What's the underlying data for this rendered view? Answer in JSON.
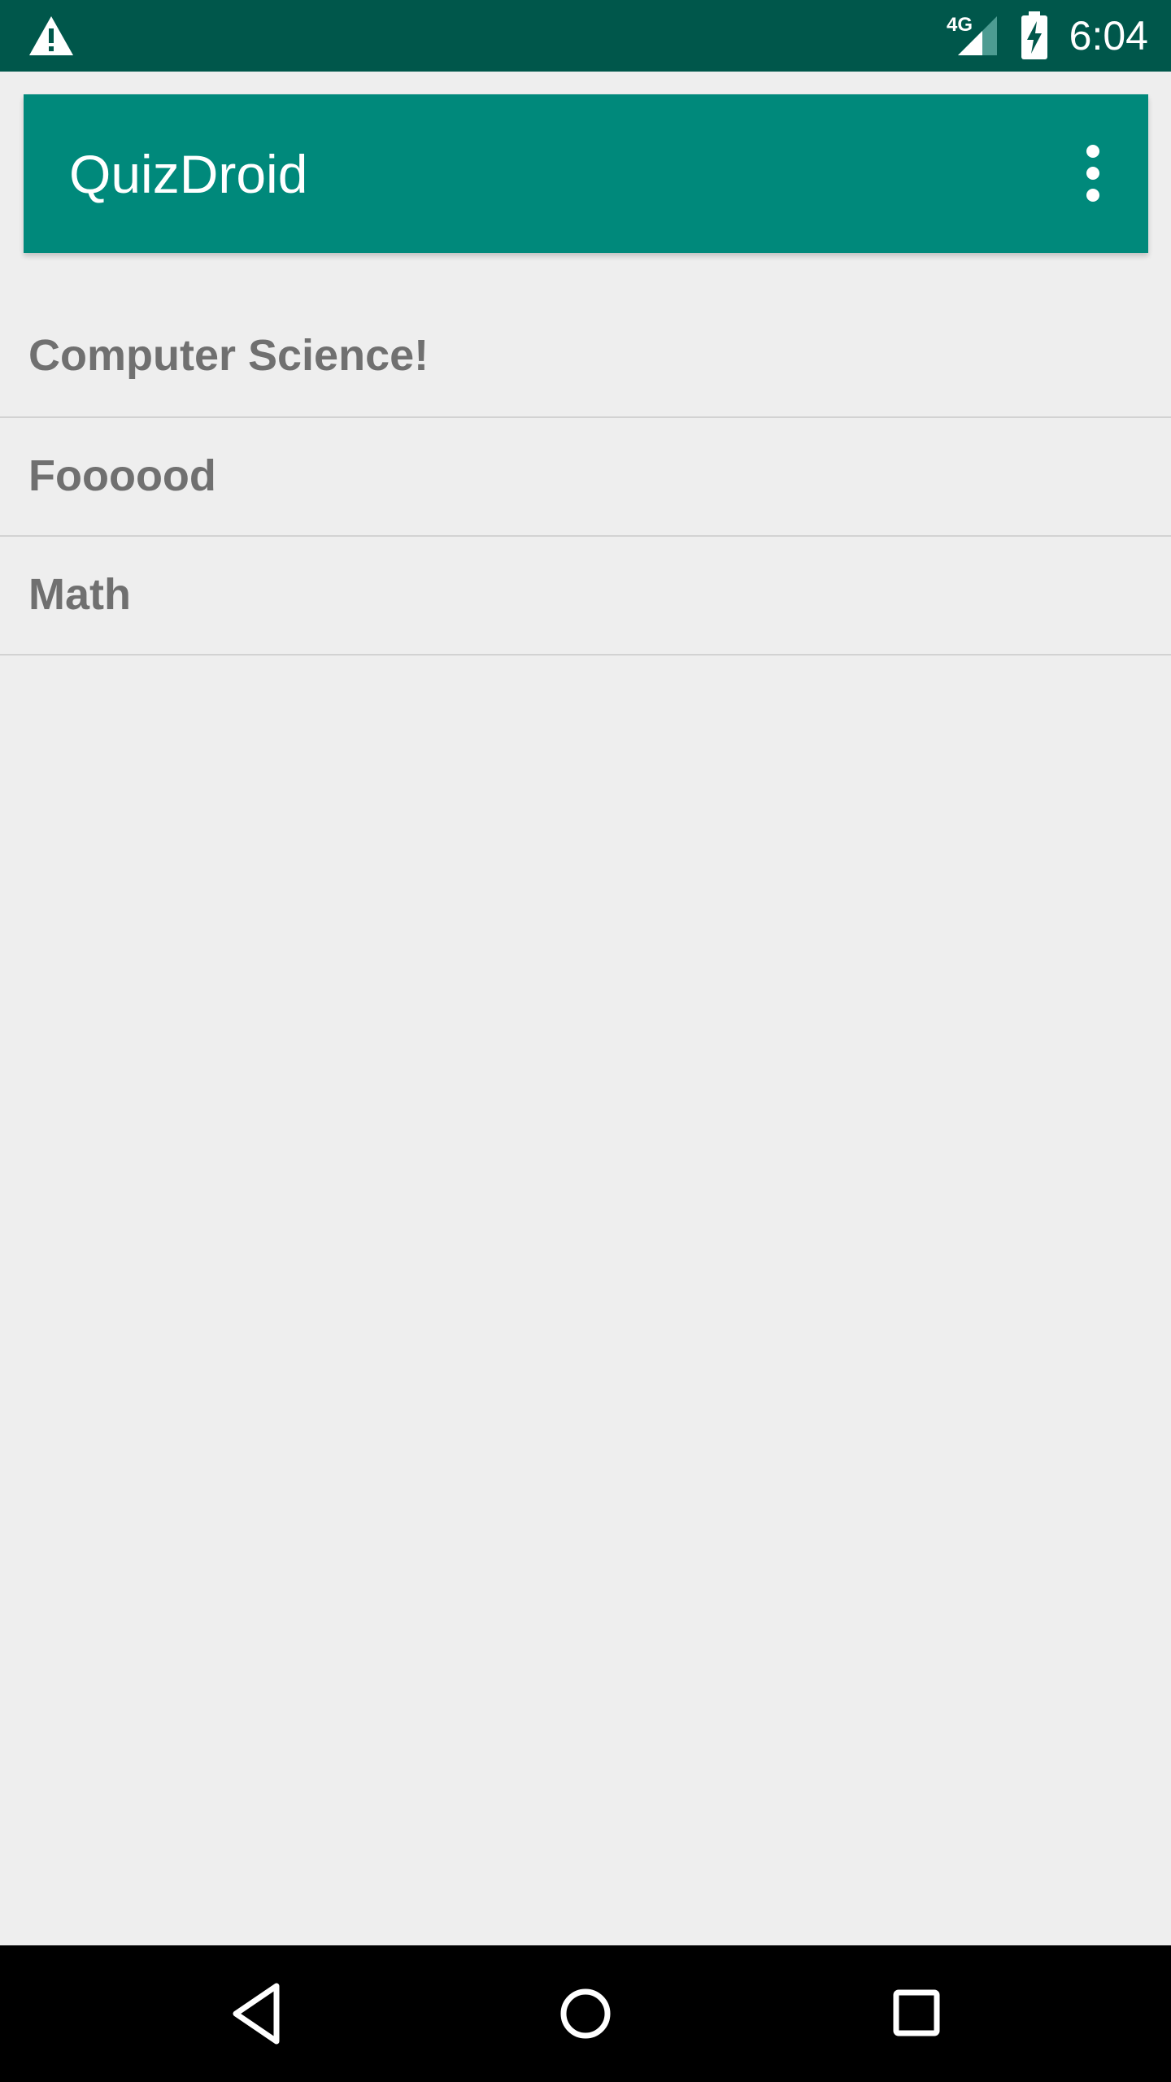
{
  "status_bar": {
    "network_type": "4G",
    "time": "6:04",
    "icons": [
      "warning-icon",
      "network-signal-icon",
      "battery-charging-icon"
    ]
  },
  "app_bar": {
    "title": "QuizDroid",
    "overflow_icon": "more-vert-icon"
  },
  "quiz_topics": [
    {
      "label": "Computer Science!"
    },
    {
      "label": "Foooood"
    },
    {
      "label": "Math"
    }
  ],
  "nav_bar": {
    "icons": [
      "back-icon",
      "home-icon",
      "recents-icon"
    ]
  },
  "colors": {
    "status_bar": "#00574b",
    "app_bar": "#00897b",
    "background": "#eeeeee",
    "list_text": "#707070",
    "divider": "#d2d2d2",
    "nav_bar": "#000000"
  }
}
